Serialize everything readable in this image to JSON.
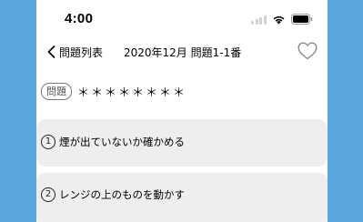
{
  "status_bar": {
    "time": "4:00"
  },
  "nav": {
    "back_label": "問題列表",
    "title": "2020年12月 問題1-1番"
  },
  "question": {
    "badge": "問題",
    "text": "＊＊＊＊＊＊＊＊"
  },
  "options": [
    {
      "number": "1",
      "text": "煙が出ていないか確かめる"
    },
    {
      "number": "2",
      "text": "レンジの上のものを動かす"
    }
  ],
  "icons": {
    "back": "chevron-left-icon",
    "favorite": "heart-outline-icon",
    "wifi": "wifi-icon",
    "battery": "battery-icon",
    "signal": "cellular-signal-icon"
  },
  "colors": {
    "background": "#5aa7e0",
    "option_background": "#eeeef0"
  }
}
